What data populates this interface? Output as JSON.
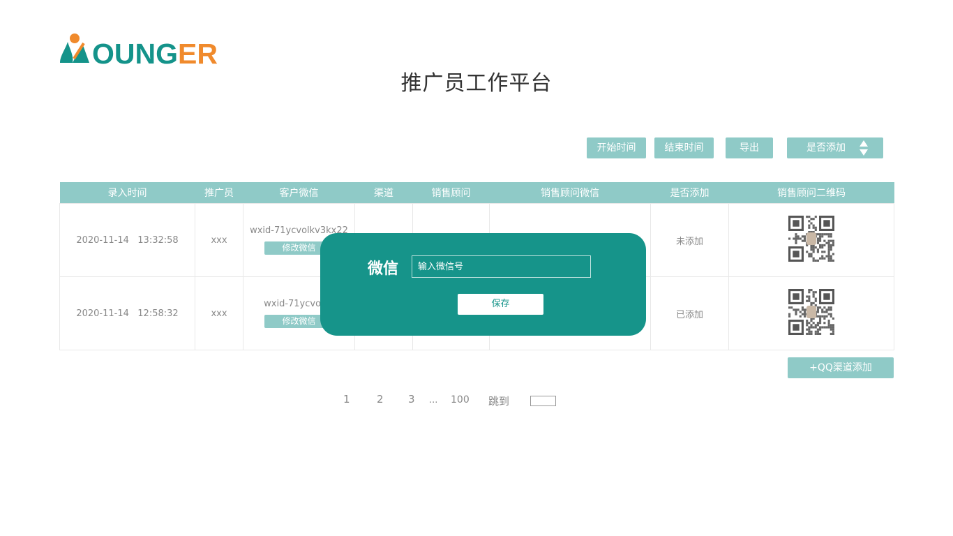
{
  "header": {
    "logo_text": "YOUNGER",
    "page_title": "推广员工作平台"
  },
  "toolbar": {
    "start_time": "开始时间",
    "end_time": "结束时间",
    "export": "导出",
    "added_filter": "是否添加"
  },
  "table": {
    "columns": [
      "录入时间",
      "推广员",
      "客户微信",
      "渠道",
      "销售顾问",
      "销售顾问微信",
      "是否添加",
      "销售顾问二维码"
    ],
    "rows": [
      {
        "time": "2020-11-14   13:32:58",
        "promoter": "xxx",
        "wechat": "wxid-71ycvolkv3kx22",
        "edit_label": "修改微信",
        "channel": "",
        "advisor": "",
        "advisor_wechat": "",
        "added": "未添加",
        "qr_icon": "qr-code-icon"
      },
      {
        "time": "2020-11-14   12:58:32",
        "promoter": "xxx",
        "wechat": "wxid-71ycvolkv",
        "edit_label": "修改微信",
        "channel": "",
        "advisor": "",
        "advisor_wechat": "",
        "added": "已添加",
        "qr_icon": "qr-code-icon"
      }
    ]
  },
  "qq_add": "+QQ渠道添加",
  "pagination": {
    "pages": [
      "1",
      "2",
      "3",
      "...",
      "100"
    ],
    "jump_label": "跳到",
    "jump_value": ""
  },
  "modal": {
    "label": "微信",
    "input_placeholder": "输入微信号",
    "save_label": "保存"
  },
  "colors": {
    "accent": "#8fcac7",
    "modal_bg": "#16948a",
    "logo_teal": "#14938a",
    "logo_orange": "#f08a2c"
  }
}
